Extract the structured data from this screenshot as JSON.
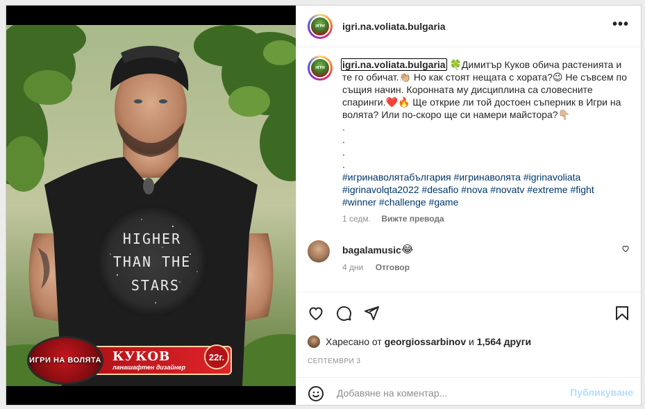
{
  "post": {
    "username": "igri.na.voliata.bulgaria",
    "more_label": "•••",
    "image": {
      "logo_text": "ИГРИ НА ВОЛЯТА",
      "contestant_name": "КУКОВ",
      "contestant_role": "ланашафтен дизайнер",
      "contestant_age": "22г.",
      "shirt_text_1": "HIGHER",
      "shirt_text_2": "THAN THE",
      "shirt_text_3": "STARS"
    },
    "caption": {
      "username": "igri.na.voliata.bulgaria",
      "emoji_clover": "🍀",
      "text_1": "Димитър Куков обича растенията и те го обичат.",
      "emoji_hand": "👏🏼",
      "text_2": " Но как стоят нещата с хората?",
      "emoji_wink": "😉",
      "text_3": " Не съвсем по същия начин. Коронната му дисциплина са словесните спаринги.",
      "emoji_heart": "❤️",
      "emoji_fire": "🔥",
      "text_4": " Ще открие ли той достоен съперник в Игри на волята? Или по-скоро ще си намери майстора?",
      "emoji_point": "👇🏼",
      "dots": [
        ".",
        ".",
        ".",
        "."
      ],
      "hashtags": [
        "#игринаволятабългария",
        "#игринаволята",
        "#igrinavoliata",
        "#igrinavolqta2022",
        "#desafio",
        "#nova",
        "#novatv",
        "#extreme",
        "#fight",
        "#winner",
        "#challenge",
        "#game"
      ]
    },
    "caption_time": "1 седм.",
    "translate_label": "Вижте превода",
    "comments": [
      {
        "username": "bagalamusic",
        "text": "😂",
        "time": "4 дни",
        "reply_label": "Отговор"
      }
    ],
    "likes": {
      "prefix": "Харесано от",
      "user": "georgiossarbinov",
      "joiner": "и",
      "others": "1,564 други"
    },
    "date": "СЕПТЕМВРИ 3",
    "add_comment": {
      "placeholder": "Добавяне на коментар...",
      "post_label": "Публикуване"
    }
  },
  "colors": {
    "hashtag": "#00376b",
    "post_button_disabled": "#b2dffc",
    "meta_gray": "#8e8e8e"
  },
  "icons": [
    "more-icon",
    "heart-icon",
    "comment-icon",
    "share-icon",
    "bookmark-icon",
    "emoji-icon",
    "small-heart-icon"
  ]
}
